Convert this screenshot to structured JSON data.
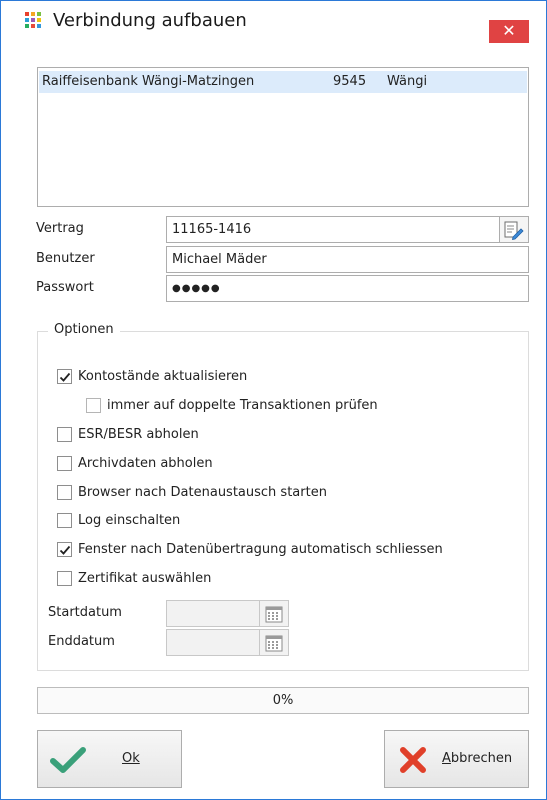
{
  "window": {
    "title": "Verbindung aufbauen",
    "close_glyph": "✕",
    "accent": "#2b79d7"
  },
  "bank_list": {
    "rows": [
      {
        "name": "Raiffeisenbank Wängi-Matzingen",
        "clearing": "9545",
        "place": "Wängi",
        "selected": true
      }
    ]
  },
  "form": {
    "contract_label": "Vertrag",
    "contract_value": "11165-1416",
    "user_label": "Benutzer",
    "user_value": "Michael Mäder",
    "password_label": "Passwort",
    "password_value": "●●●●●"
  },
  "options": {
    "group_title": "Optionen",
    "items": [
      {
        "label": "Kontostände aktualisieren",
        "checked": true
      },
      {
        "label": "immer auf doppelte Transaktionen prüfen",
        "checked": false
      },
      {
        "label": "ESR/BESR abholen",
        "checked": false
      },
      {
        "label": "Archivdaten abholen",
        "checked": false
      },
      {
        "label": "Browser nach Datenaustausch starten",
        "checked": false
      },
      {
        "label": "Log einschalten",
        "checked": false
      },
      {
        "label": "Fenster nach Datenübertragung automatisch schliessen",
        "checked": true
      },
      {
        "label": "Zertifikat auswählen",
        "checked": false
      }
    ],
    "start_date_label": "Startdatum",
    "start_date_value": "",
    "end_date_label": "Enddatum",
    "end_date_value": ""
  },
  "progress": {
    "percent": 0,
    "text": "0%"
  },
  "buttons": {
    "ok_label": "Ok",
    "cancel_label": "Abbrechen"
  },
  "icons": {
    "app": "app-grid-icon",
    "contract_picker": "edit-document-icon",
    "calendar": "calendar-icon",
    "ok": "checkmark-icon",
    "cancel": "red-x-icon"
  }
}
